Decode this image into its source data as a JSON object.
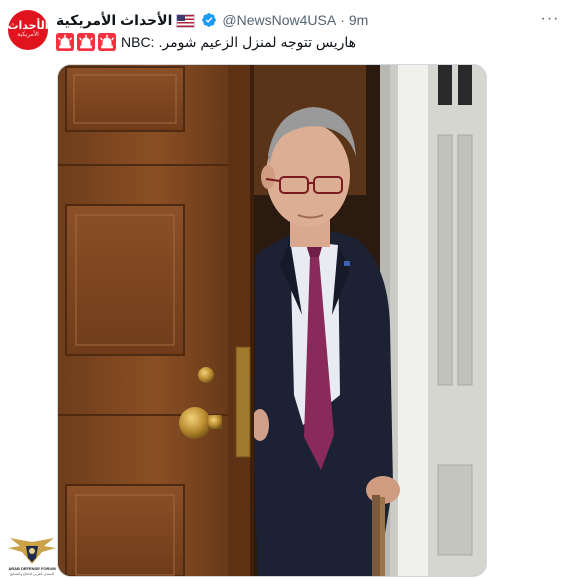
{
  "tweet": {
    "author": {
      "display_name": "الأحداث الأمريكية",
      "handle": "@NewsNow4USA",
      "avatar_text": "الأحداث",
      "avatar_subtext": "الأمريكية",
      "verified": true
    },
    "separator": "·",
    "timestamp": "9m",
    "more_label": "···",
    "text_prefix_icons": [
      "siren-icon",
      "siren-icon",
      "siren-icon"
    ],
    "source": "NBC:",
    "text": ".هاريس تتوجه لمنزل الزعيم شومر",
    "media": {
      "alt": "photo"
    }
  },
  "watermark": {
    "line1": "ARAB DEFENSE FORUM",
    "line2": "المنتدى العربي للدفاع والتسليح"
  },
  "colors": {
    "accent": "#1d9bf0",
    "avatar_bg": "#e0141e",
    "muted_text": "#536471",
    "siren_red": "#f4323f"
  }
}
